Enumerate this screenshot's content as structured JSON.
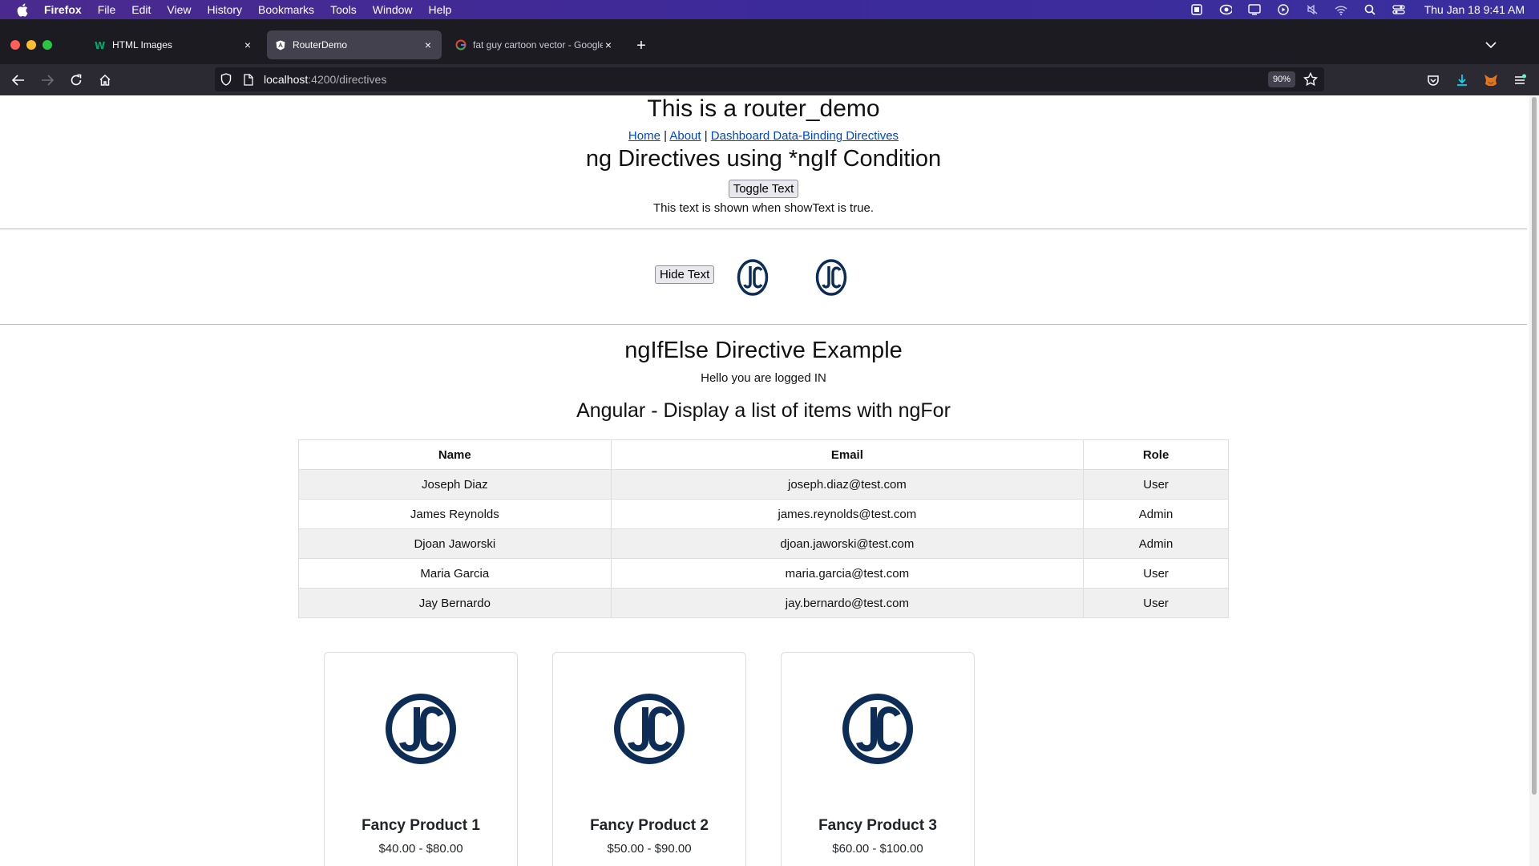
{
  "menubar": {
    "app": "Firefox",
    "items": [
      "File",
      "Edit",
      "View",
      "History",
      "Bookmarks",
      "Tools",
      "Window",
      "Help"
    ],
    "clock": "Thu Jan 18  9:41 AM"
  },
  "tabs": [
    {
      "label": "HTML Images",
      "icon": "w3schools-icon"
    },
    {
      "label": "RouterDemo",
      "icon": "angular-icon"
    },
    {
      "label": "fat guy cartoon vector - Google",
      "icon": "google-icon"
    }
  ],
  "urlbar": {
    "host": "localhost",
    "path": ":4200/directives",
    "zoom": "90%"
  },
  "page": {
    "title": "This is a router_demo",
    "links": {
      "home": "Home",
      "about": "About",
      "dashboard": "Dashboard Data-Binding Directives",
      "sep": " | "
    },
    "ngif_heading": "ng Directives using *ngIf Condition",
    "toggle_button": "Toggle Text",
    "shown_text": "This text is shown when showText is true.",
    "hide_button": "Hide Text",
    "ngifelse_heading": "ngIfElse Directive Example",
    "logged_in": "Hello you are logged IN",
    "ngfor_heading": "Angular - Display a list of items with ngFor",
    "table": {
      "headers": [
        "Name",
        "Email",
        "Role"
      ],
      "rows": [
        [
          "Joseph Diaz",
          "joseph.diaz@test.com",
          "User"
        ],
        [
          "James Reynolds",
          "james.reynolds@test.com",
          "Admin"
        ],
        [
          "Djoan Jaworski",
          "djoan.jaworski@test.com",
          "Admin"
        ],
        [
          "Maria Garcia",
          "maria.garcia@test.com",
          "User"
        ],
        [
          "Jay Bernardo",
          "jay.bernardo@test.com",
          "User"
        ]
      ]
    },
    "products": [
      {
        "name": "Fancy Product 1",
        "price": "$40.00 - $80.00"
      },
      {
        "name": "Fancy Product 2",
        "price": "$50.00 - $90.00"
      },
      {
        "name": "Fancy Product 3",
        "price": "$60.00 - $100.00"
      }
    ]
  },
  "colors": {
    "logo": "#0d2d57",
    "link": "#0047cc",
    "menubar": "#3d2a9a"
  }
}
